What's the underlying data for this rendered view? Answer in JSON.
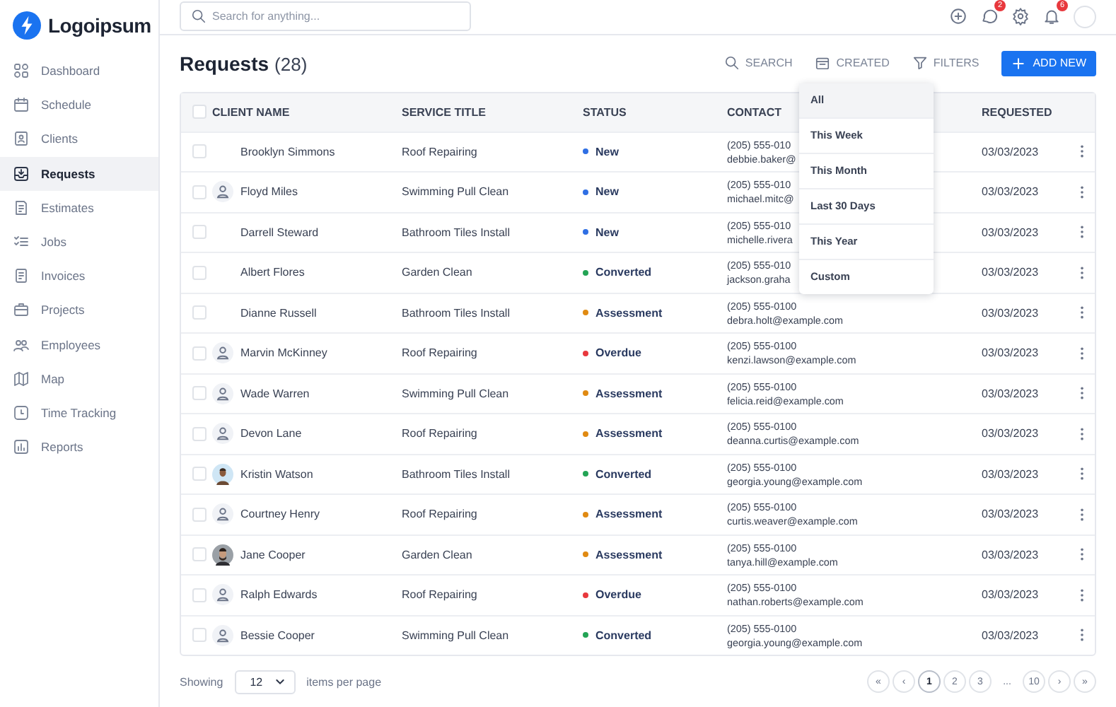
{
  "logo": {
    "text": "Logoipsum"
  },
  "search": {
    "placeholder": "Search for anything..."
  },
  "header_badges": {
    "messages": "2",
    "notifications": "6"
  },
  "sidebar": {
    "items": [
      {
        "label": "Dashboard",
        "selected": false
      },
      {
        "label": "Schedule",
        "selected": false
      },
      {
        "label": "Clients",
        "selected": false
      },
      {
        "label": "Requests",
        "selected": true
      },
      {
        "label": "Estimates",
        "selected": false
      },
      {
        "label": "Jobs",
        "selected": false
      },
      {
        "label": "Invoices",
        "selected": false
      },
      {
        "label": "Projects",
        "selected": false
      },
      {
        "label": "Employees",
        "selected": false
      },
      {
        "label": "Map",
        "selected": false
      },
      {
        "label": "Time Tracking",
        "selected": false
      },
      {
        "label": "Reports",
        "selected": false
      }
    ]
  },
  "page": {
    "title": "Requests",
    "count": "(28)"
  },
  "toolbar": {
    "buttons": [
      "SEARCH",
      "CREATED",
      "FILTERS"
    ],
    "primary": "ADD NEW"
  },
  "date_menu": {
    "items": [
      {
        "label": "All",
        "selected": true
      },
      {
        "label": "This Week",
        "selected": false
      },
      {
        "label": "This Month",
        "selected": false
      },
      {
        "label": "Last 30 Days",
        "selected": false
      },
      {
        "label": "This Year",
        "selected": false
      },
      {
        "label": "Custom",
        "selected": false
      }
    ]
  },
  "table": {
    "header_checked": false,
    "columns": [
      "CLIENT NAME",
      "SERVICE TITLE",
      "STATUS",
      "CONTACT",
      "REQUESTED"
    ],
    "rows": [
      {
        "checked": false,
        "kind": "plain",
        "client": "Brooklyn Simmons",
        "service": "Roof Repairing",
        "status": "New",
        "color": "#2f6fe4",
        "phone": "(205) 555-010",
        "email": "debbie.baker@",
        "requested": "03/03/2023"
      },
      {
        "checked": false,
        "kind": "icon",
        "client": "Floyd Miles",
        "service": "Swimming Pull Clean",
        "status": "New",
        "color": "#2f6fe4",
        "phone": "(205) 555-010",
        "email": "michael.mitc@",
        "requested": "03/03/2023"
      },
      {
        "checked": false,
        "kind": "plain",
        "client": "Darrell Steward",
        "service": "Bathroom Tiles Install",
        "status": "New",
        "color": "#2f6fe4",
        "phone": "(205) 555-010",
        "email": "michelle.rivera",
        "requested": "03/03/2023"
      },
      {
        "checked": false,
        "kind": "plain",
        "client": "Albert Flores",
        "service": "Garden Clean",
        "status": "Converted",
        "color": "#23a455",
        "phone": "(205) 555-010",
        "email": "jackson.graha",
        "requested": "03/03/2023"
      },
      {
        "checked": false,
        "kind": "plain",
        "client": "Dianne Russell",
        "service": "Bathroom Tiles Install",
        "status": "Assessment",
        "color": "#e08a12",
        "phone": "(205) 555-0100",
        "email": "debra.holt@example.com",
        "requested": "03/03/2023"
      },
      {
        "checked": false,
        "kind": "icon",
        "client": "Marvin McKinney",
        "service": "Roof Repairing",
        "status": "Overdue",
        "color": "#e8383d",
        "phone": "(205) 555-0100",
        "email": "kenzi.lawson@example.com",
        "requested": "03/03/2023"
      },
      {
        "checked": false,
        "kind": "icon",
        "client": "Wade Warren",
        "service": "Swimming Pull Clean",
        "status": "Assessment",
        "color": "#e08a12",
        "phone": "(205) 555-0100",
        "email": "felicia.reid@example.com",
        "requested": "03/03/2023"
      },
      {
        "checked": false,
        "kind": "icon",
        "client": "Devon Lane",
        "service": "Roof Repairing",
        "status": "Assessment",
        "color": "#e08a12",
        "phone": "(205) 555-0100",
        "email": "deanna.curtis@example.com",
        "requested": "03/03/2023"
      },
      {
        "checked": false,
        "kind": "photo",
        "client": "Kristin Watson",
        "service": "Bathroom Tiles Install",
        "status": "Converted",
        "color": "#23a455",
        "phone": "(205) 555-0100",
        "email": "georgia.young@example.com",
        "requested": "03/03/2023"
      },
      {
        "checked": false,
        "kind": "icon",
        "client": "Courtney Henry",
        "service": "Roof Repairing",
        "status": "Assessment",
        "color": "#e08a12",
        "phone": "(205) 555-0100",
        "email": "curtis.weaver@example.com",
        "requested": "03/03/2023"
      },
      {
        "checked": false,
        "kind": "photo",
        "client": "Jane Cooper",
        "service": "Garden Clean",
        "status": "Assessment",
        "color": "#e08a12",
        "phone": "(205) 555-0100",
        "email": "tanya.hill@example.com",
        "requested": "03/03/2023"
      },
      {
        "checked": false,
        "kind": "icon",
        "client": "Ralph Edwards",
        "service": "Roof Repairing",
        "status": "Overdue",
        "color": "#e8383d",
        "phone": "(205) 555-0100",
        "email": "nathan.roberts@example.com",
        "requested": "03/03/2023"
      },
      {
        "checked": false,
        "kind": "icon",
        "client": "Bessie Cooper",
        "service": "Swimming Pull Clean",
        "status": "Converted",
        "color": "#23a455",
        "phone": "(205) 555-0100",
        "email": "georgia.young@example.com",
        "requested": "03/03/2023"
      }
    ]
  },
  "footer": {
    "showing": "Showing",
    "page_size": "12",
    "per_page": "items per page",
    "pages": [
      {
        "label": "«",
        "kind": "nav",
        "selected": false
      },
      {
        "label": "‹",
        "kind": "nav",
        "selected": false
      },
      {
        "label": "1",
        "kind": "page",
        "selected": true
      },
      {
        "label": "2",
        "kind": "page",
        "selected": false
      },
      {
        "label": "3",
        "kind": "page",
        "selected": false
      },
      {
        "label": "...",
        "kind": "ellipsis",
        "selected": false
      },
      {
        "label": "10",
        "kind": "page",
        "selected": false
      },
      {
        "label": "›",
        "kind": "nav",
        "selected": false
      },
      {
        "label": "»",
        "kind": "nav",
        "selected": false
      }
    ]
  }
}
